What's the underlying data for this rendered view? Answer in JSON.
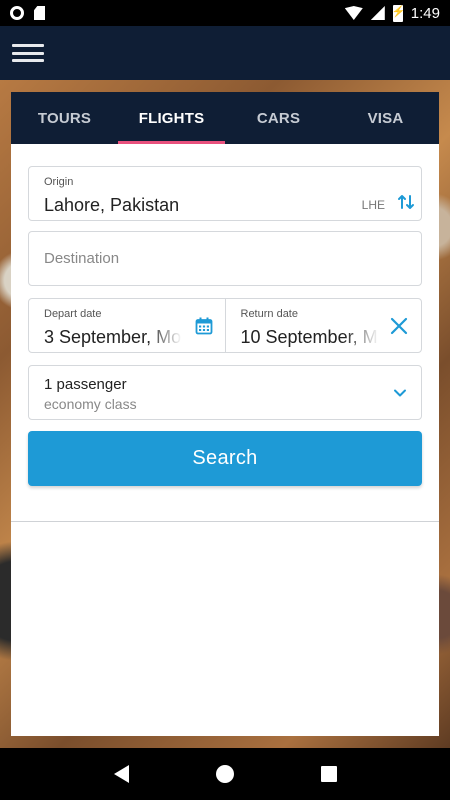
{
  "status_bar": {
    "time": "1:49"
  },
  "tabs": [
    {
      "label": "TOURS",
      "active": false
    },
    {
      "label": "FLIGHTS",
      "active": true
    },
    {
      "label": "CARS",
      "active": false
    },
    {
      "label": "VISA",
      "active": false
    }
  ],
  "origin": {
    "label": "Origin",
    "value": "Lahore, Pakistan",
    "code": "LHE"
  },
  "destination": {
    "placeholder": "Destination"
  },
  "depart": {
    "label": "Depart date",
    "value": "3 September, Mo"
  },
  "return": {
    "label": "Return date",
    "value": "10 September, M"
  },
  "passengers": {
    "count": "1 passenger",
    "class": "economy class"
  },
  "search": {
    "label": "Search"
  },
  "colors": {
    "accent": "#1e9ad6",
    "tab_indicator": "#e8517d",
    "header": "#0f1e35"
  }
}
